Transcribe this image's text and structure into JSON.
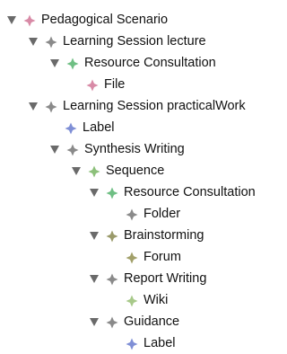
{
  "tree": {
    "nodes": [
      {
        "label": "Pedagogical Scenario",
        "expanded": true,
        "icon": "pink-diamond-icon",
        "color": "#d88aa6"
      },
      {
        "label": "Learning Session lecture",
        "expanded": true,
        "icon": "gray-diamond-icon",
        "color": "#8a8a8a"
      },
      {
        "label": "Resource Consultation",
        "expanded": true,
        "icon": "green-diamond-icon",
        "color": "#6fbf84"
      },
      {
        "label": "File",
        "expanded": null,
        "icon": "pink-diamond-icon",
        "color": "#d88aa6"
      },
      {
        "label": "Learning Session practicalWork",
        "expanded": true,
        "icon": "gray-diamond-icon",
        "color": "#8a8a8a"
      },
      {
        "label": "Label",
        "expanded": null,
        "icon": "blue-diamond-icon",
        "color": "#7f8fd6"
      },
      {
        "label": "Synthesis Writing",
        "expanded": true,
        "icon": "gray-diamond-icon",
        "color": "#8a8a8a"
      },
      {
        "label": "Sequence",
        "expanded": true,
        "icon": "green-diamond-icon",
        "color": "#8cc07a"
      },
      {
        "label": "Resource Consultation",
        "expanded": true,
        "icon": "green-diamond-icon",
        "color": "#6fbf84"
      },
      {
        "label": "Folder",
        "expanded": null,
        "icon": "gray-diamond-icon",
        "color": "#8a8a8a"
      },
      {
        "label": "Brainstorming",
        "expanded": true,
        "icon": "olive-diamond-icon",
        "color": "#9a9a6a"
      },
      {
        "label": "Forum",
        "expanded": null,
        "icon": "olive-diamond-icon",
        "color": "#a2a06a"
      },
      {
        "label": "Report Writing",
        "expanded": true,
        "icon": "gray-diamond-icon",
        "color": "#8a8a8a"
      },
      {
        "label": "Wiki",
        "expanded": null,
        "icon": "lightgreen-diamond-icon",
        "color": "#a8c98a"
      },
      {
        "label": "Guidance",
        "expanded": true,
        "icon": "gray-diamond-icon",
        "color": "#8a8a8a"
      },
      {
        "label": "Label",
        "expanded": null,
        "icon": "blue-diamond-icon",
        "color": "#7f8fd6"
      }
    ]
  }
}
